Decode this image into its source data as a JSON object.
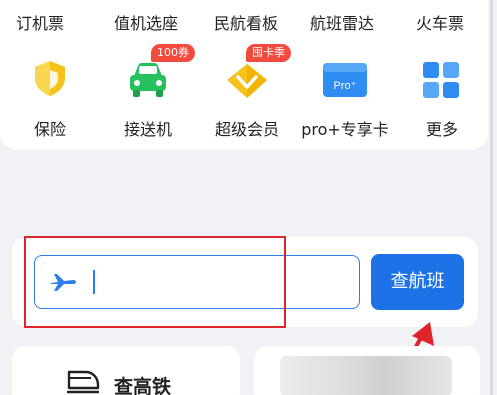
{
  "top_links": [
    "订机票",
    "值机选座",
    "民航看板",
    "航班雷达",
    "火车票"
  ],
  "services": [
    {
      "label": "保险",
      "icon": "shield-icon",
      "badge": ""
    },
    {
      "label": "接送机",
      "icon": "car-icon",
      "badge": "100券"
    },
    {
      "label": "超级会员",
      "icon": "diamond-icon",
      "badge": "囤卡季"
    },
    {
      "label": "pro+专享卡",
      "icon": "pro-card-icon",
      "badge": ""
    },
    {
      "label": "更多",
      "icon": "grid-icon",
      "badge": ""
    }
  ],
  "search": {
    "value": "",
    "button_label": "查航班"
  },
  "bottom": {
    "train_label": "查高铁"
  },
  "colors": {
    "primary": "#1d72e8",
    "badge": "#f24b3d",
    "annotation": "#e0242b",
    "shield": "#f6c21c",
    "car": "#26c05c",
    "diamond": "#f6c21c"
  }
}
